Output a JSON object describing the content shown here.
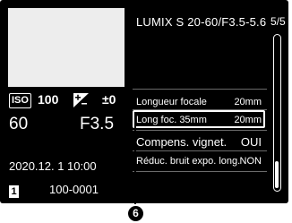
{
  "info": {
    "iso_label": "ISO",
    "iso_value": "100",
    "ev_value": "±0",
    "shutter": "60",
    "aperture": "F3.5",
    "datetime": "2020.12.  1 10:00",
    "folder_icon_text": "1",
    "file_number": "100-0001"
  },
  "menu": {
    "lens_name": "LUMIX S 20-60/F3.5-5.6",
    "page_indicator": "5/5",
    "rows": [
      {
        "label": "Longueur focale",
        "value": "20mm"
      },
      {
        "label": "Long foc. 35mm",
        "value": "20mm"
      },
      {
        "label": "Compens. vignet.",
        "value": "OUI"
      },
      {
        "label": "Réduc. bruit expo. long.",
        "value": "NON"
      }
    ],
    "selected_row": 1,
    "scroll_position": 1.0
  },
  "callout": {
    "number": "6"
  },
  "icons": [
    "iso-icon",
    "exposure-compensation-icon",
    "folder-icon"
  ],
  "colors": {
    "screen": "#000000",
    "text": "#ffffff",
    "thumbnail": "#ededed",
    "separator": "#6a6a6a"
  }
}
